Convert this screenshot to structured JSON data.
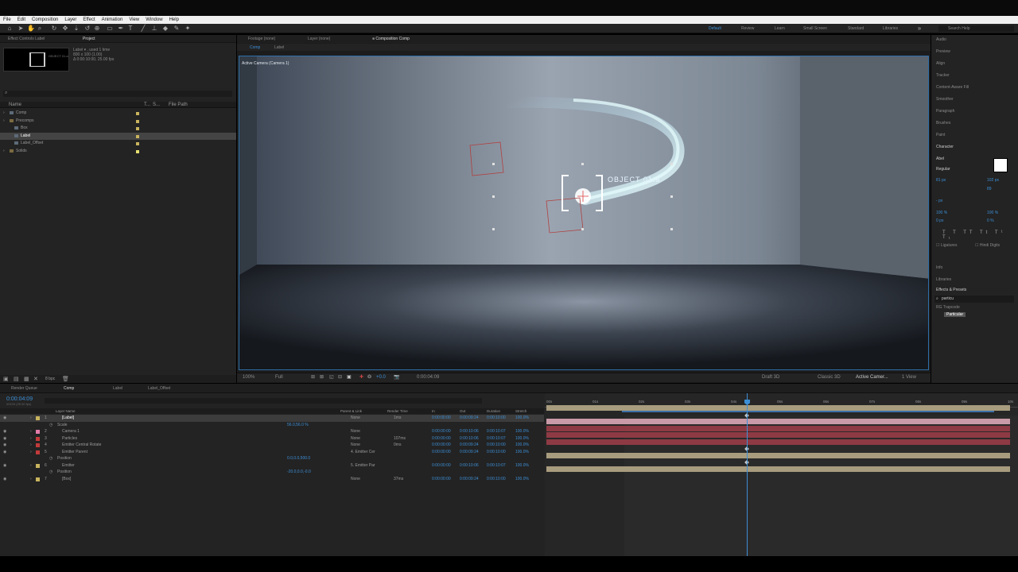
{
  "menu": [
    "File",
    "Edit",
    "Composition",
    "Layer",
    "Effect",
    "Animation",
    "View",
    "Window",
    "Help"
  ],
  "workspaces": [
    {
      "label": "Default",
      "active": true
    },
    {
      "label": "Review",
      "active": false
    },
    {
      "label": "Learn",
      "active": false
    },
    {
      "label": "Small Screen",
      "active": false
    },
    {
      "label": "Standard",
      "active": false
    },
    {
      "label": "Libraries",
      "active": false
    }
  ],
  "search_help_placeholder": "Search Help",
  "project": {
    "tabs": [
      "Effect Controls Label",
      "Project"
    ],
    "thumb_text": "OBJECT 01.a",
    "info": [
      "Label ▾ , used 1 time",
      "800 x 100 (1.00)",
      "Δ 0:00:10:00, 25.00 fps"
    ],
    "columns": [
      "Name",
      "T...",
      "S...",
      "File Path"
    ],
    "items": [
      {
        "name": "Comp",
        "indent": 0,
        "color": "#c9b45e",
        "selected": false
      },
      {
        "name": "Precomps",
        "indent": 0,
        "color": "#c9b45e",
        "selected": false
      },
      {
        "name": "Box",
        "indent": 1,
        "color": "#c9b45e",
        "selected": false
      },
      {
        "name": "Label",
        "indent": 1,
        "color": "#c9b45e",
        "selected": true
      },
      {
        "name": "Label_Offset",
        "indent": 1,
        "color": "#c9b45e",
        "selected": false
      },
      {
        "name": "Solids",
        "indent": 0,
        "color": "#e8e070",
        "selected": false
      }
    ],
    "bpc": "8 bpc"
  },
  "viewer": {
    "tabs": [
      "Footage (none)",
      "Layer (none)",
      "Composition Comp"
    ],
    "crumbs": [
      "Comp",
      "Label"
    ],
    "camera_label": "Active Camera (Camera 1)",
    "object_label": "OBJECT 01.a",
    "zoom": "100%",
    "resolution": "Full",
    "exposure": "+0.0",
    "timecode": "0:00:04:09",
    "renderer": "Draft 3D",
    "renderer_mode": "Classic 3D",
    "view": "Active Camer...",
    "views": "1 View"
  },
  "right_panels": {
    "items": [
      "Audio",
      "Preview",
      "Align",
      "Tracker",
      "Content-Aware Fill",
      "Smoother",
      "Paragraph",
      "Brushes",
      "Paint"
    ],
    "character": {
      "title": "Character",
      "font": "Abel",
      "style": "Regular",
      "size": "81 px",
      "leading": "102 px",
      "tracking": "89",
      "stroke": "- px",
      "vscale": "100 %",
      "hscale": "100 %",
      "baseline": "0 px",
      "tsume": "0 %",
      "ligatures": "Ligatures",
      "hindi": "Hindi Digits"
    },
    "info": "Info",
    "libraries": "Libraries",
    "effects": {
      "title": "Effects & Presets",
      "search": "particu",
      "group": "RG Trapcode",
      "item": "Particular"
    }
  },
  "timeline": {
    "tabs": [
      "Render Queue",
      "Comp",
      "Label",
      "Label_Offset"
    ],
    "timecode": "0:00:04:09",
    "fps": "00109 (25.00 fps)",
    "headers": [
      "Layer Name",
      "Parent & Link",
      "Render Time",
      "In",
      "Out",
      "Duration",
      "Stretch"
    ],
    "ruler": [
      "00s",
      "01s",
      "02s",
      "03s",
      "04s",
      "05s",
      "06s",
      "07s",
      "08s",
      "09s",
      "10s"
    ],
    "layers": [
      {
        "num": "1",
        "name": "[Label]",
        "color": "#c9b45e",
        "parent": "None",
        "render": "1ms",
        "in": "0:00:00:00",
        "out": "0:00:09:24",
        "dur": "0:00:10:00",
        "str": "100.0%",
        "bar": "tan",
        "selected": true
      },
      {
        "num": "",
        "name": "Scale",
        "prop": true,
        "value": "56.0,56.0 %"
      },
      {
        "num": "2",
        "name": "Camera 1",
        "color": "#e37caa",
        "parent": "None",
        "render": "",
        "in": "0:00:00:00",
        "out": "0:00:10:06",
        "dur": "0:00:10:07",
        "str": "100.0%",
        "bar": "pink"
      },
      {
        "num": "3",
        "name": "Particles",
        "color": "#c23a3a",
        "parent": "None",
        "render": "107ms",
        "in": "0:00:00:00",
        "out": "0:00:10:06",
        "dur": "0:00:10:07",
        "str": "100.0%",
        "bar": "red"
      },
      {
        "num": "4",
        "name": "Emitter Central Rotate",
        "color": "#c23a3a",
        "parent": "None",
        "render": "0ms",
        "in": "0:00:00:00",
        "out": "0:00:09:24",
        "dur": "0:00:10:00",
        "str": "100.0%",
        "bar": "red"
      },
      {
        "num": "5",
        "name": "Emitter Parent",
        "color": "#c23a3a",
        "parent": "4. Emitter Cer",
        "render": "",
        "in": "0:00:00:00",
        "out": "0:00:09:24",
        "dur": "0:00:10:00",
        "str": "100.0%",
        "bar": "red"
      },
      {
        "num": "",
        "name": "Position",
        "prop": true,
        "value": "0.0,0.0,500.0"
      },
      {
        "num": "6",
        "name": "Emitter",
        "color": "#c9b45e",
        "parent": "5. Emitter Par",
        "render": "",
        "in": "0:00:00:00",
        "out": "0:00:10:06",
        "dur": "0:00:10:07",
        "str": "100.0%",
        "bar": "tan"
      },
      {
        "num": "",
        "name": "Position",
        "prop": true,
        "value": "-20.0,0.0,-0.0"
      },
      {
        "num": "7",
        "name": "[Box]",
        "color": "#c9b45e",
        "parent": "None",
        "render": "37ms",
        "in": "0:00:00:00",
        "out": "0:00:09:24",
        "dur": "0:00:10:00",
        "str": "100.0%",
        "bar": "tan"
      }
    ],
    "colors": {
      "tan": "#a89c7e",
      "pink": "#c99aa8",
      "red": "#8e3a44"
    }
  }
}
